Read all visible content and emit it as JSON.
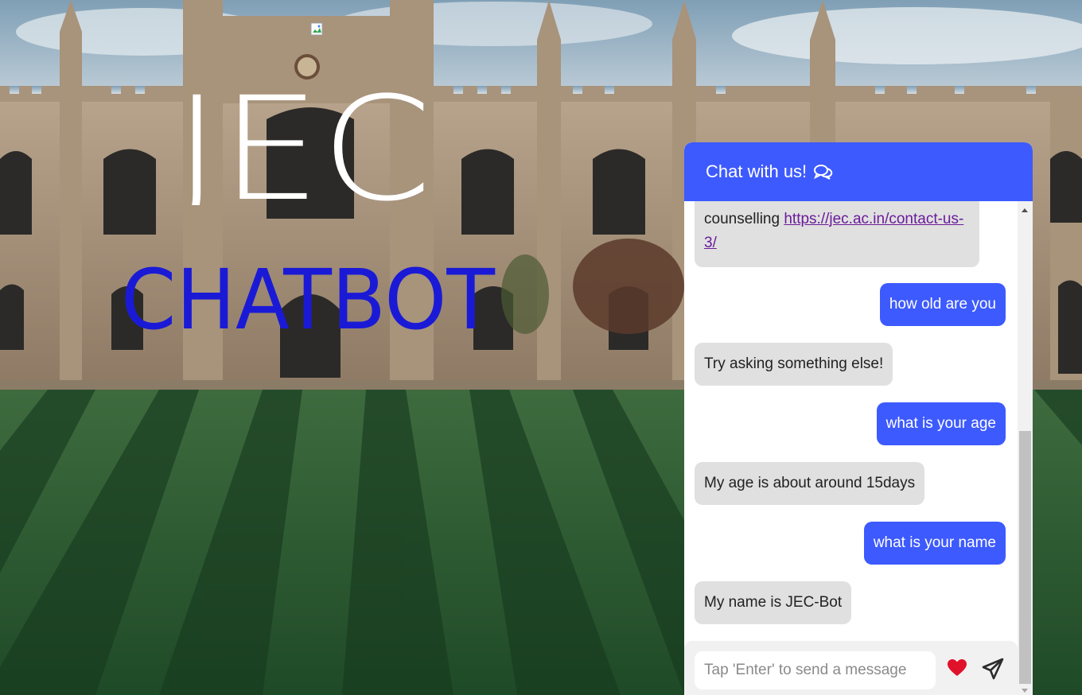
{
  "page": {
    "background": "university-building-lawn",
    "broken_image_icon": "broken-image-icon",
    "logo": {
      "line1": "JEC",
      "line2": "CHATBOT",
      "line1_color": "#ffffff",
      "line2_color": "#1a1ad6"
    }
  },
  "chat": {
    "header_title": "Chat with us!",
    "header_icon": "comments-icon",
    "accent_color": "#3d5afe",
    "messages": [
      {
        "sender": "bot",
        "text": "counselling ",
        "link": "https://jec.ac.in/contact-us-3/"
      },
      {
        "sender": "user",
        "text": "how old are you"
      },
      {
        "sender": "bot",
        "text": "Try asking something else!"
      },
      {
        "sender": "user",
        "text": "what is your age"
      },
      {
        "sender": "bot",
        "text": "My age is about around 15days"
      },
      {
        "sender": "user",
        "text": "what is your name"
      },
      {
        "sender": "bot",
        "text": "My name is JEC-Bot"
      }
    ],
    "input": {
      "placeholder": "Tap 'Enter' to send a message",
      "value": ""
    },
    "heart_icon": "heart-icon",
    "heart_color": "#e0112b",
    "send_icon": "paper-plane-icon"
  }
}
